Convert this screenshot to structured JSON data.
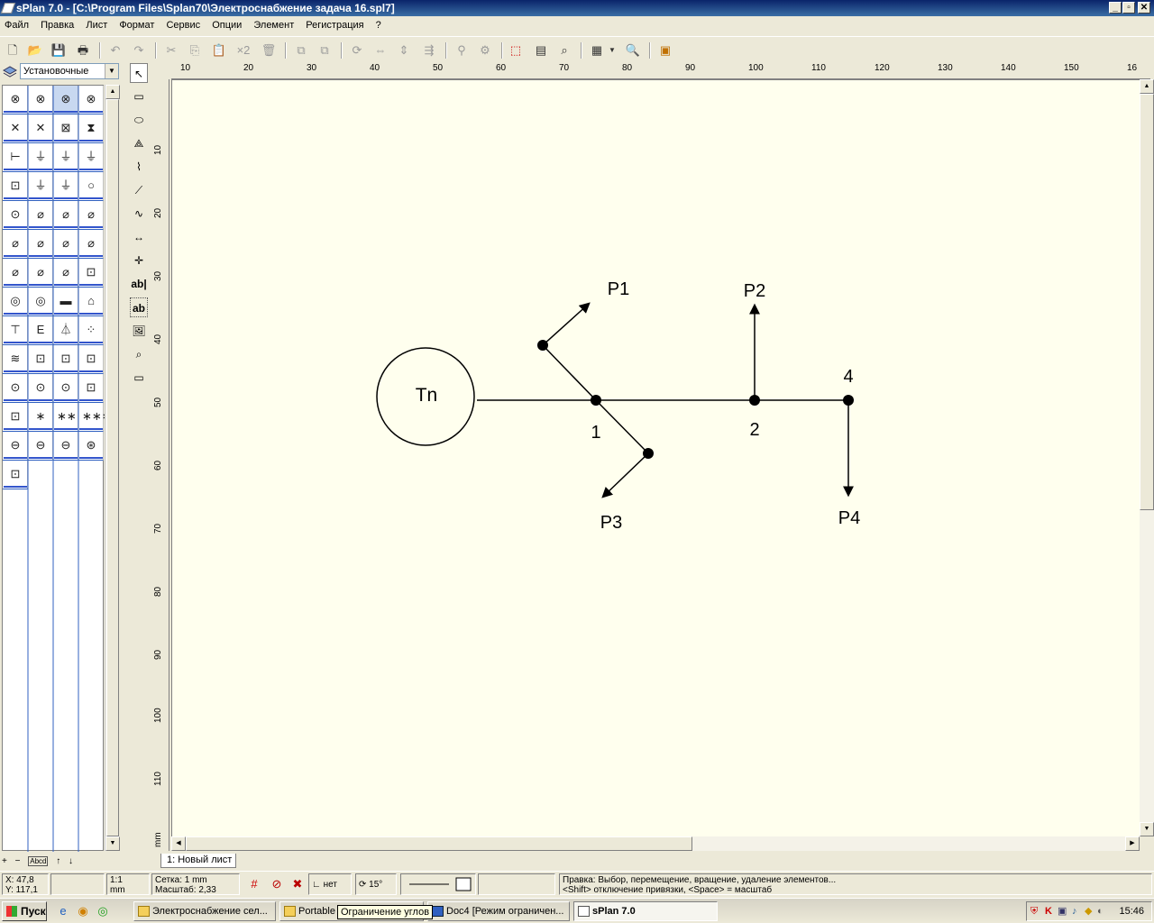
{
  "title": "sPlan 7.0 - [C:\\Program Files\\Splan70\\Электроснабжение задача 16.spl7]",
  "window_buttons": {
    "min": "_",
    "max": "▫",
    "close": "✕"
  },
  "menu": [
    "Файл",
    "Правка",
    "Лист",
    "Формат",
    "Сервис",
    "Опции",
    "Элемент",
    "Регистрация",
    "?"
  ],
  "toolbar": {
    "x2_label": "×2"
  },
  "library": {
    "selected": "Установочные",
    "symbols": [
      "⊗",
      "⊗",
      "⊗",
      "⊗",
      "✕",
      "✕",
      "⊠",
      "⧗",
      "⊢",
      "⏚",
      "⏚",
      "⏚",
      "⊡",
      "⏚",
      "⏚",
      "○",
      "⊙",
      "⌀",
      "⌀",
      "⌀",
      "⌀",
      "⌀",
      "⌀",
      "⌀",
      "⌀",
      "⌀",
      "⌀",
      "⊡",
      "◎",
      "◎",
      "▬",
      "⌂",
      "⊤",
      "E",
      "⏃",
      "⁘",
      "≋",
      "⊡",
      "⊡",
      "⊡",
      "⊙",
      "⊙",
      "⊙",
      "⊡",
      "⊡",
      "∗",
      "∗∗",
      "∗∗∗",
      "⊖",
      "⊖",
      "⊖",
      "⊛",
      "⊡"
    ],
    "bottom_tools": [
      "+",
      "−",
      "Abcd",
      "↑",
      "↓"
    ]
  },
  "ruler": {
    "h": [
      "10",
      "20",
      "30",
      "40",
      "50",
      "60",
      "70",
      "80",
      "90",
      "100",
      "110",
      "120",
      "130",
      "140",
      "150",
      "16"
    ],
    "v": [
      "10",
      "20",
      "30",
      "40",
      "50",
      "60",
      "70",
      "80",
      "90",
      "100",
      "110"
    ],
    "unit": "mm"
  },
  "schematic": {
    "source_label": "Tn",
    "nodes": {
      "n1": "1",
      "n2": "2",
      "n4": "4"
    },
    "loads": {
      "p1": "P1",
      "p2": "P2",
      "p3": "P3",
      "p4": "P4"
    }
  },
  "sheet_tab": "1: Новый лист",
  "status": {
    "x": "X: 47,8",
    "y": "Y: 117,1",
    "scale_ratio": "1:1",
    "scale_unit": "mm",
    "grid": "Сетка: 1 mm",
    "zoom": "Масштаб:   2,33",
    "snap": "нет",
    "angle": "15°",
    "hint_line1": "Правка: Выбор, перемещение, вращение, удаление элементов...",
    "hint_line2": "<Shift> отключение привязки, <Space> = масштаб"
  },
  "taskbar": {
    "start": "Пуск",
    "tasks": [
      "Электроснабжение сел...",
      "Portable",
      "Doc4 [Режим ограничен...",
      "sPlan 7.0"
    ],
    "tooltip": "Ограничение углов",
    "clock": "15:46"
  },
  "colors": {
    "canvas": "#ffffee",
    "titlebar": "#0a246a",
    "face": "#ece9d8"
  }
}
